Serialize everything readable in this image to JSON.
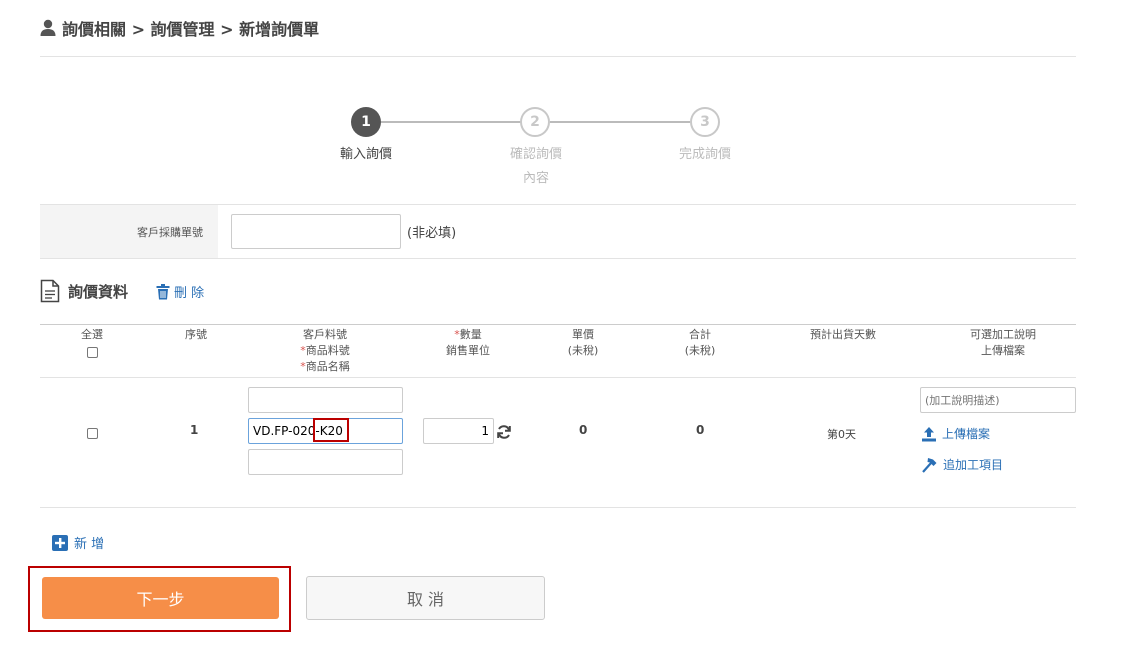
{
  "breadcrumb": {
    "text": "詢價相關 > 詢價管理 > 新增詢價單"
  },
  "steps": [
    {
      "number": "1",
      "label": "輸入詢價",
      "label2": ""
    },
    {
      "number": "2",
      "label": "確認詢價",
      "label2": "內容"
    },
    {
      "number": "3",
      "label": "完成詢價",
      "label2": ""
    }
  ],
  "po_field": {
    "label": "客戶採購單號",
    "value": "",
    "hint": "(非必填)"
  },
  "section": {
    "title": "詢價資料",
    "delete_label": "刪 除"
  },
  "table": {
    "headers": {
      "select_all": "全選",
      "seq": "序號",
      "cust_part": "客戶料號",
      "prod_part_star": "*",
      "prod_part": "商品料號",
      "prod_name_star": "*",
      "prod_name": "商品名稱",
      "qty_star": "*",
      "qty": "數量",
      "unit": "銷售單位",
      "price": "單價",
      "price_sub": "(未稅)",
      "total": "合計",
      "total_sub": "(未稅)",
      "ship_days": "預計出貨天數",
      "option_1": "可選加工說明",
      "option_2": "上傳檔案"
    },
    "rows": [
      {
        "seq": "1",
        "cust_part": "",
        "prod_part": "VD.FP-020-K20",
        "prod_name": "",
        "qty": "1",
        "price": "0",
        "total": "0",
        "ship_days": "第0天",
        "process_placeholder": "(加工說明描述)",
        "upload_label": "上傳檔案",
        "add_process_label": "追加工項目"
      }
    ]
  },
  "add_label": "新 增",
  "buttons": {
    "next": "下一步",
    "cancel": "取 消"
  }
}
